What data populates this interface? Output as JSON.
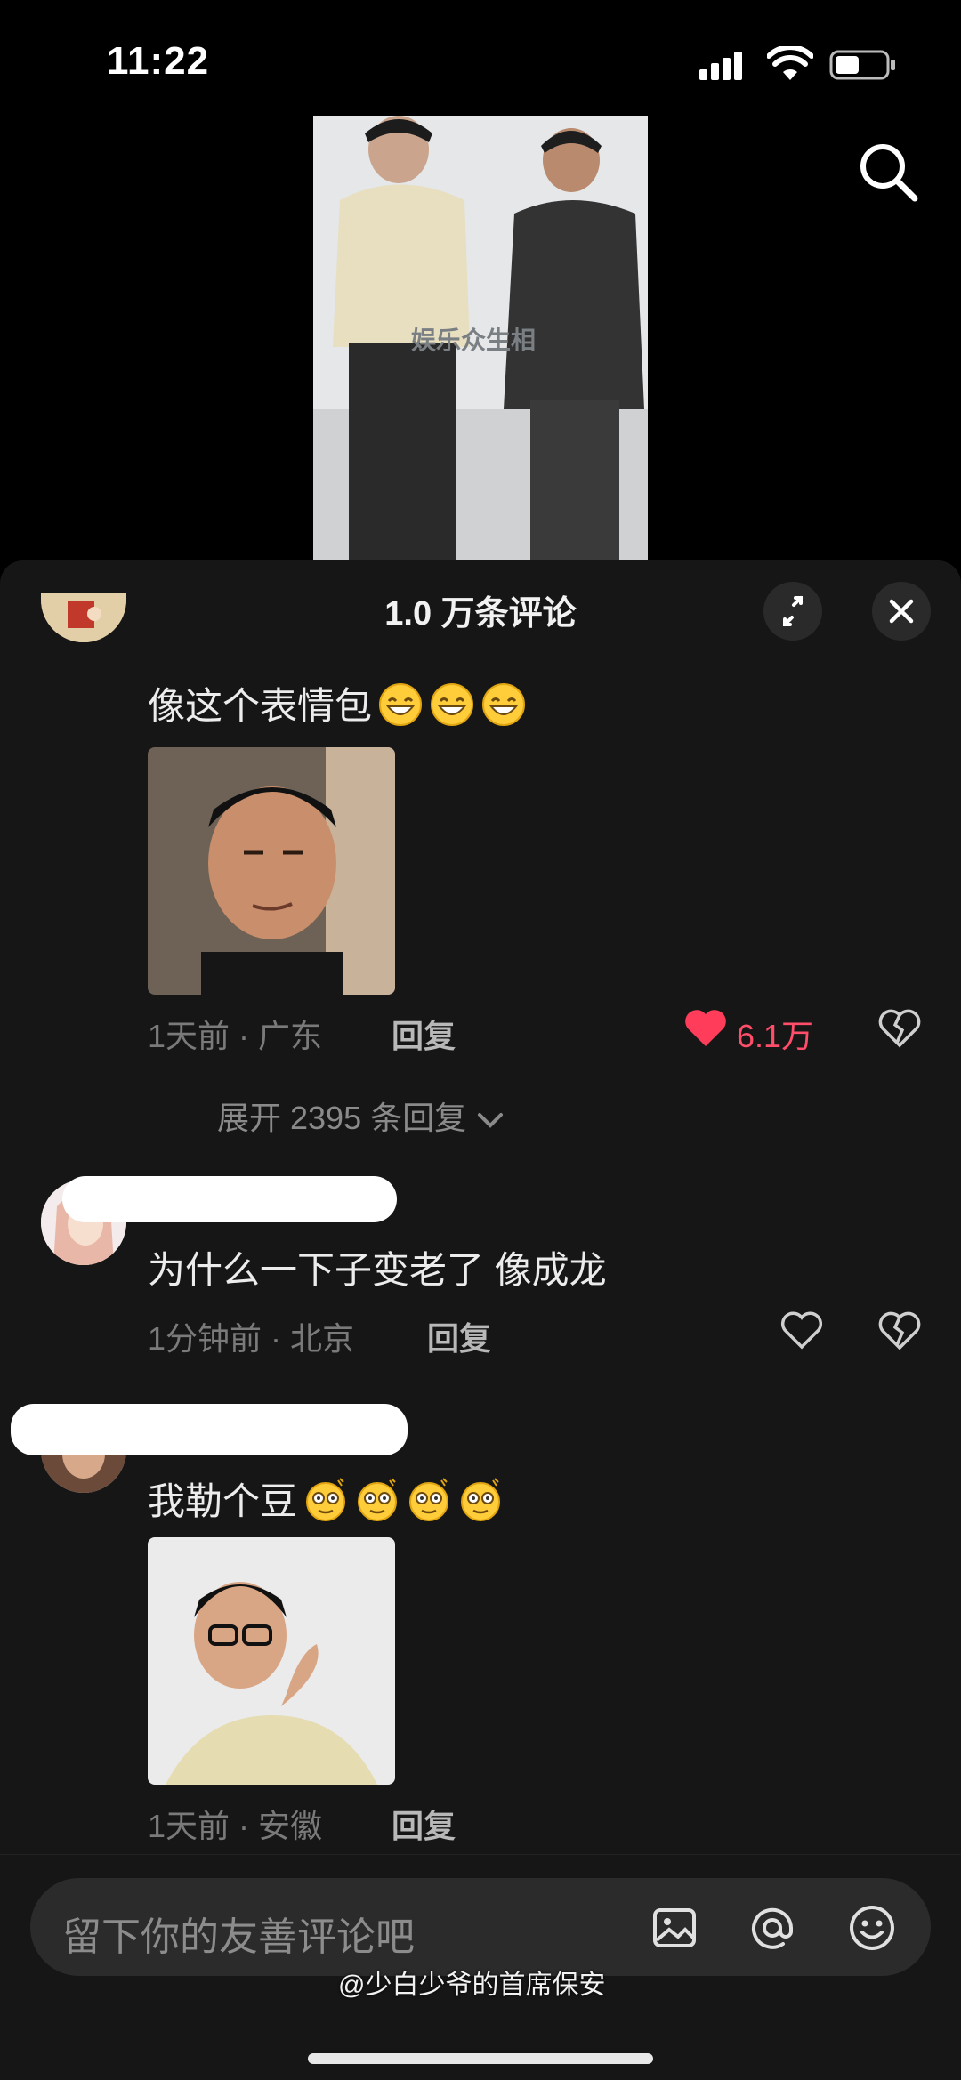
{
  "status_bar": {
    "time": "11:22"
  },
  "video": {
    "watermark": "娱乐众生相"
  },
  "sheet": {
    "title": "1.0 万条评论"
  },
  "comments": [
    {
      "text": "像这个表情包",
      "emoji": "grin-emoji",
      "time": "1天前 · 广东",
      "reply": "回复",
      "likes": "6.1万",
      "liked": true
    },
    {
      "expand": "展开 2395 条回复"
    },
    {
      "text": "为什么一下子变老了 像成龙",
      "time": "1分钟前 · 北京",
      "reply": "回复"
    },
    {
      "text": "我勒个豆",
      "emoji": "dizzy-emoji",
      "time": "1天前 · 安徽",
      "reply": "回复"
    }
  ],
  "input": {
    "placeholder": "留下你的友善评论吧"
  },
  "footer": {
    "watermark": "@少白少爷的首席保安"
  },
  "colors": {
    "accent": "#ff4d6a",
    "sheet_bg": "#161616"
  }
}
